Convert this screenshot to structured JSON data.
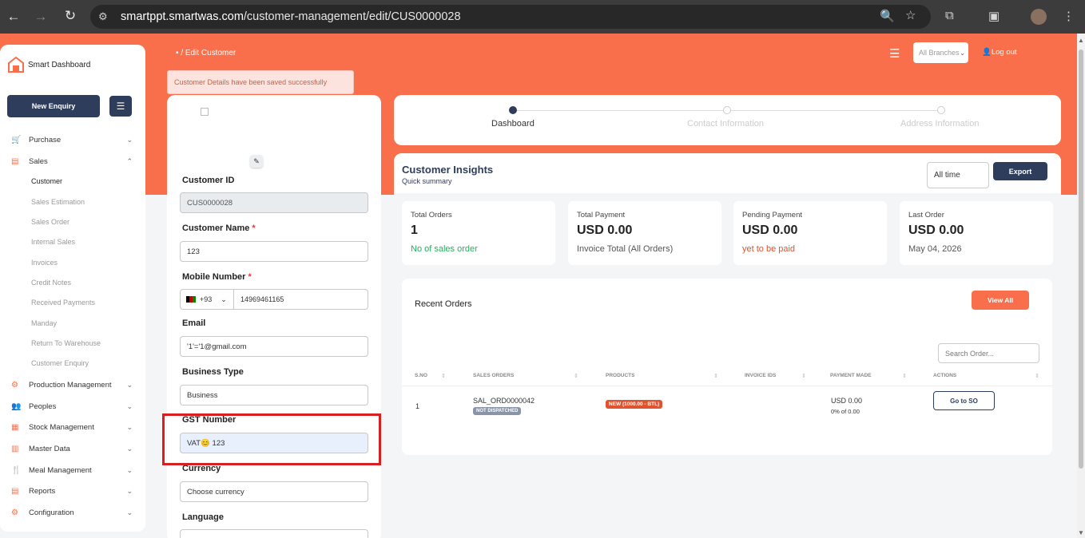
{
  "browser": {
    "url_host": "smartppt.smartwas.com",
    "url_path": "/customer-management/edit/CUS0000028"
  },
  "sidebar": {
    "brand": "Smart Dashboard",
    "new_enquiry": "New Enquiry",
    "items": [
      {
        "label": "Purchase",
        "icon": "cart-icon"
      },
      {
        "label": "Sales",
        "icon": "sales-icon"
      },
      {
        "label": "Production Management",
        "icon": "factory-icon"
      },
      {
        "label": "Peoples",
        "icon": "people-icon"
      },
      {
        "label": "Stock Management",
        "icon": "stock-icon"
      },
      {
        "label": "Master Data",
        "icon": "database-icon"
      },
      {
        "label": "Meal Management",
        "icon": "meal-icon"
      },
      {
        "label": "Reports",
        "icon": "reports-icon"
      },
      {
        "label": "Configuration",
        "icon": "config-icon"
      }
    ],
    "sales_sub": [
      "Customer",
      "Sales Estimation",
      "Sales Order",
      "Internal Sales",
      "Invoices",
      "Credit Notes",
      "Received Payments",
      "Manday",
      "Return To Warehouse",
      "Customer Enquiry"
    ]
  },
  "topbar": {
    "breadcrumb": "Edit Customer",
    "branch": "All Branches",
    "logout": "Log out"
  },
  "toast": "Customer Details have been saved successfully",
  "form": {
    "customer_id_label": "Customer ID",
    "customer_id": "CUS0000028",
    "customer_name_label": "Customer Name",
    "customer_name": "123",
    "mobile_label": "Mobile Number",
    "dial_code": "+93",
    "mobile": "14969461165",
    "email_label": "Email",
    "email": "'1'='1@gmail.com",
    "business_type_label": "Business Type",
    "business_type": "Business",
    "gst_label": "GST Number",
    "gst": "VAT😊 123",
    "currency_label": "Currency",
    "currency_placeholder": "Choose currency",
    "language_label": "Language"
  },
  "steps": [
    "Dashboard",
    "Contact Information",
    "Address Information"
  ],
  "insights": {
    "title": "Customer Insights",
    "subtitle": "Quick summary",
    "range": "All time",
    "export": "Export",
    "stats": [
      {
        "title": "Total Orders",
        "value": "1",
        "note": "No of sales order"
      },
      {
        "title": "Total Payment",
        "value": "USD 0.00",
        "note": "Invoice Total (All Orders)"
      },
      {
        "title": "Pending Payment",
        "value": "USD 0.00",
        "note": "yet to be paid"
      },
      {
        "title": "Last Order",
        "value": "USD 0.00",
        "note": "May 04, 2026"
      }
    ]
  },
  "recent_orders": {
    "title": "Recent Orders",
    "view_all": "View All",
    "search_placeholder": "Search Order...",
    "columns": [
      "S.NO",
      "SALES ORDERS",
      "PRODUCTS",
      "INVOICE IDS",
      "PAYMENT MADE",
      "ACTIONS"
    ],
    "rows": [
      {
        "sno": "1",
        "order": "SAL_ORD0000042",
        "status": "NOT DISPATCHED",
        "product": "NEW (1000.00 - BTL)",
        "payment": "USD 0.00",
        "payment_note": "0% of 0.00",
        "action": "Go to SO"
      }
    ]
  },
  "colors": {
    "accent": "#f96f4b",
    "navy": "#2f3d5c",
    "highlight": "#d81e1e"
  }
}
